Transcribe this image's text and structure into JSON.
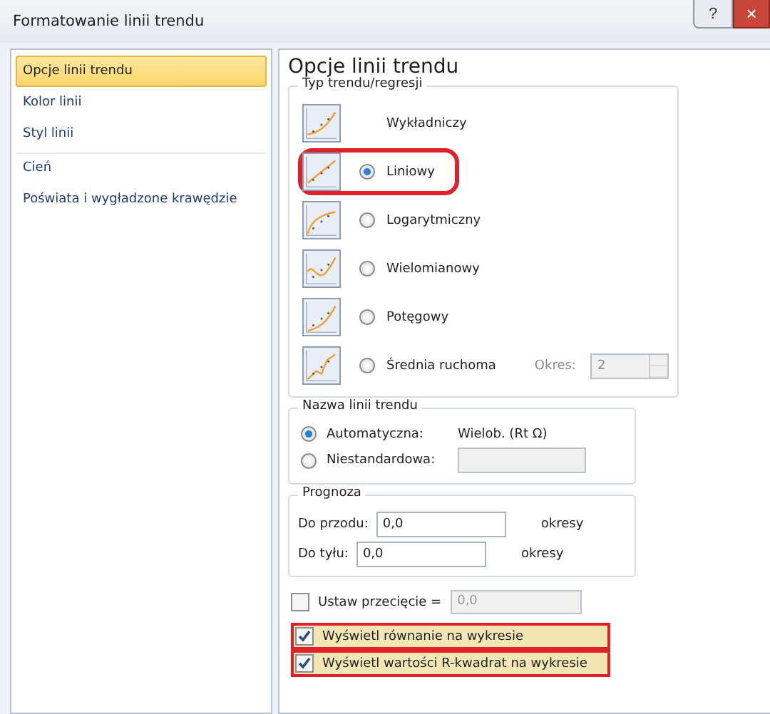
{
  "window": {
    "title": "Formatowanie linii trendu",
    "help": "?",
    "close": "×"
  },
  "sidebar": {
    "items": [
      {
        "label": "Opcje linii trendu",
        "selected": true,
        "group_start": false
      },
      {
        "label": "Kolor linii",
        "selected": false,
        "group_start": false
      },
      {
        "label": "Styl linii",
        "selected": false,
        "group_start": false
      },
      {
        "label": "Cień",
        "selected": false,
        "group_start": true
      },
      {
        "label": "Poświata i wygładzone krawędzie",
        "selected": false,
        "group_start": false
      }
    ]
  },
  "panel": {
    "heading": "Opcje linii trendu",
    "trend_type": {
      "legend": "Typ trendu/regresji",
      "items": [
        {
          "label": "Wykładniczy",
          "kind": "plain",
          "highlighted": false
        },
        {
          "label": "Liniowy",
          "kind": "radio",
          "selected": true,
          "highlighted": true
        },
        {
          "label": "Logarytmiczny",
          "kind": "radio",
          "selected": false,
          "highlighted": false
        },
        {
          "label": "Wielomianowy",
          "kind": "radio",
          "selected": false,
          "highlighted": false
        },
        {
          "label": "Potęgowy",
          "kind": "radio",
          "selected": false,
          "highlighted": false
        },
        {
          "label": "Średnia ruchoma",
          "kind": "radio",
          "selected": false,
          "highlighted": false
        }
      ],
      "period": {
        "label": "Okres:",
        "value": "2",
        "disabled": true
      }
    },
    "trend_name": {
      "legend": "Nazwa linii trendu",
      "options": [
        {
          "label": "Automatyczna:",
          "selected": true,
          "value": "Wielob. (Rt Ω)",
          "kind": "text"
        },
        {
          "label": "Niestandardowa:",
          "selected": false,
          "kind": "field"
        }
      ]
    },
    "forecast": {
      "legend": "Prognoza",
      "rows": [
        {
          "label": "Do przodu:",
          "value": "0,0",
          "unit": "okresy"
        },
        {
          "label": "Do tyłu:",
          "value": "0,0",
          "unit": "okresy"
        }
      ]
    },
    "intercept": {
      "label": "Ustaw przecięcie =",
      "checked": false,
      "value": "0,0"
    },
    "display_options": [
      {
        "label": "Wyświetl równanie na wykresie",
        "checked": true,
        "highlighted": true
      },
      {
        "label": "Wyświetl wartości R-kwadrat na wykresie",
        "checked": true,
        "highlighted": true
      }
    ]
  }
}
